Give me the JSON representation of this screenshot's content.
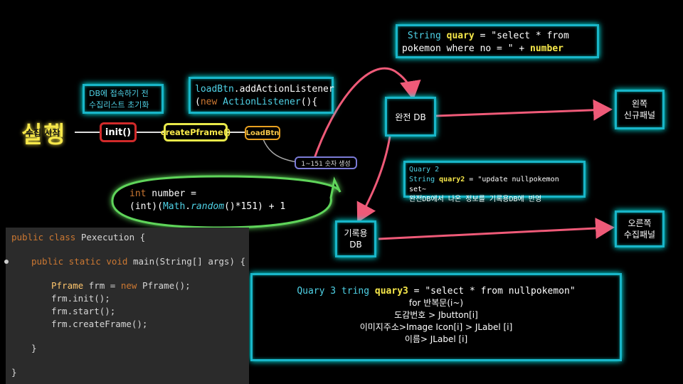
{
  "run_label": "실행",
  "run_underlabel": "수집 시작",
  "flow": {
    "init": "init()",
    "createPframe": "createPframe()",
    "loadBtn": "LoadBtn"
  },
  "init_note": {
    "line1": "DB에 접속하기 전",
    "line2": "수집리스트 초기화"
  },
  "listener_note": {
    "line1_a": "loadBtn",
    "line1_b": ".addActionListener",
    "line2_a": "(",
    "line2_new": "new",
    "line2_b": " ActionListener",
    "line2_c": "(){"
  },
  "random_tag": "1~151 숫자 생성",
  "random_bubble": {
    "kw": "int",
    "var": " number =",
    "line2_a": "(int)(",
    "line2_math": "Math",
    "line2_dot": ".",
    "line2_random": "random",
    "line2_b": "()*151) + 1"
  },
  "query1": {
    "a": "String ",
    "b": "quary",
    "c": " = \"select * from",
    "line2_a": "pokemon where no = \" + ",
    "line2_b": "number"
  },
  "node_full_db": "완전 DB",
  "node_record_db": {
    "line1": "기록용",
    "line2": "DB"
  },
  "left_panel": {
    "line1": "왼쪽",
    "line2": "신규패널"
  },
  "right_panel": {
    "line1": "오른쪽",
    "line2": "수집패널"
  },
  "query2": {
    "title": "Quary 2",
    "a": "String ",
    "b": "quary2",
    "c": " = \"update nullpokemon set~",
    "line3": "완전DB에서 나온 정보를 기록용DB에 반영"
  },
  "query3": {
    "a": "Quary 3 tring ",
    "b": "quary3",
    "c": " = \"select * from nullpokemon\"",
    "l2": "for 반복문(i~)",
    "l3": "도감번호 > Jbutton[i]",
    "l4": "이미지주소>Image Icon[i] > JLabel [i]",
    "l5": "이름> JLabel [i]"
  },
  "code": {
    "l1_kw": "public class",
    "l1_name": " Pexecution {",
    "l2_kw": "public static void",
    "l2_rest": " main(String[] args) {",
    "l3_cls": "Pframe",
    "l3_a": " frm = ",
    "l3_new": "new",
    "l3_b": " Pframe();",
    "l4": "frm.init();",
    "l5": "frm.start();",
    "l6": "frm.createFrame();",
    "l7": "}",
    "l8": "}"
  },
  "colors": {
    "accent": "#19b6c9",
    "arrow": "#ef5a78",
    "yellow": "#f7e84a",
    "green": "#5fd45a"
  }
}
